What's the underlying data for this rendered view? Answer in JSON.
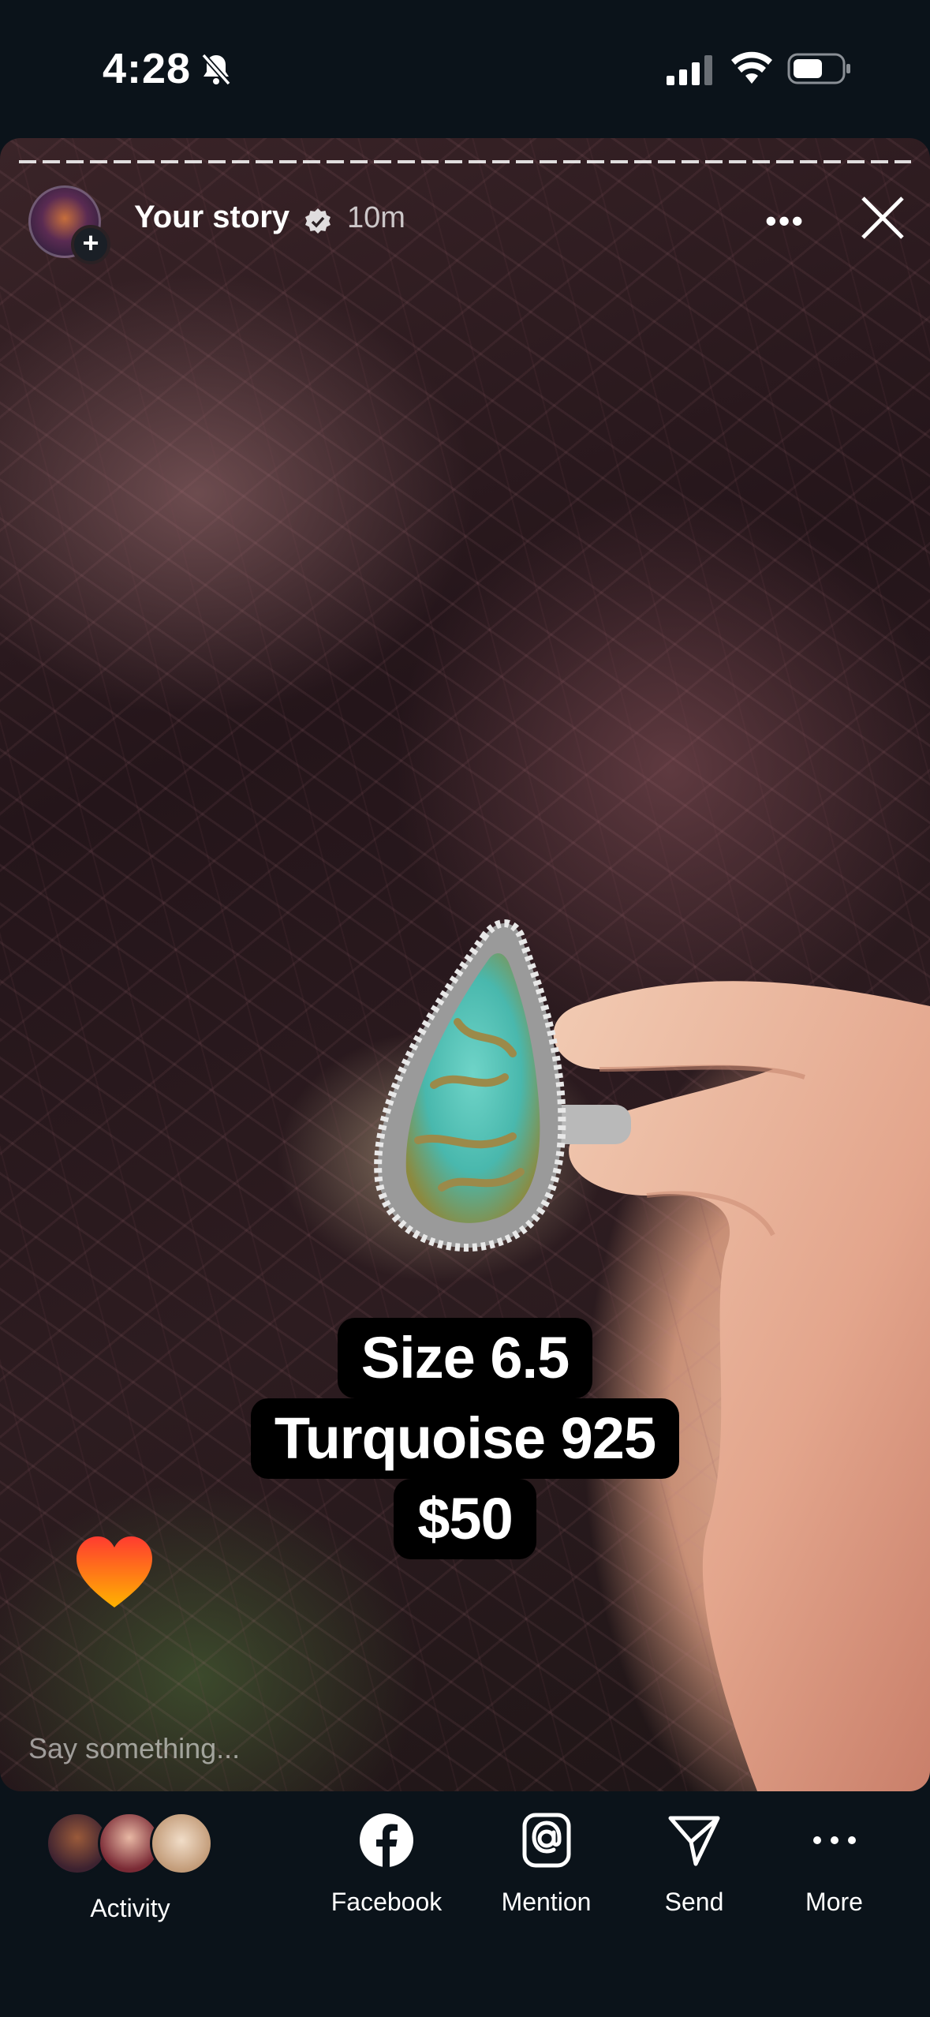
{
  "status_bar": {
    "time": "4:28",
    "bell_icon": "bell-slash-icon",
    "signal_icon": "cellular-signal-icon",
    "wifi_icon": "wifi-icon",
    "battery_icon": "battery-icon"
  },
  "story": {
    "user": "Your story",
    "time_ago": "10m",
    "caption": [
      "Size 6.5",
      "Turquoise 925",
      "$50"
    ],
    "reply_placeholder": "Say something...",
    "colors": {
      "caption_bg": "#000000",
      "heart_top": "#ff3b30",
      "heart_bottom": "#ffb300"
    }
  },
  "bottom_nav": {
    "items": [
      {
        "label": "Activity",
        "icon": "activity-avatars"
      },
      {
        "label": "Facebook",
        "icon": "facebook-icon"
      },
      {
        "label": "Mention",
        "icon": "at-sign-icon"
      },
      {
        "label": "Send",
        "icon": "send-icon"
      },
      {
        "label": "More",
        "icon": "more-horizontal-icon"
      }
    ]
  }
}
